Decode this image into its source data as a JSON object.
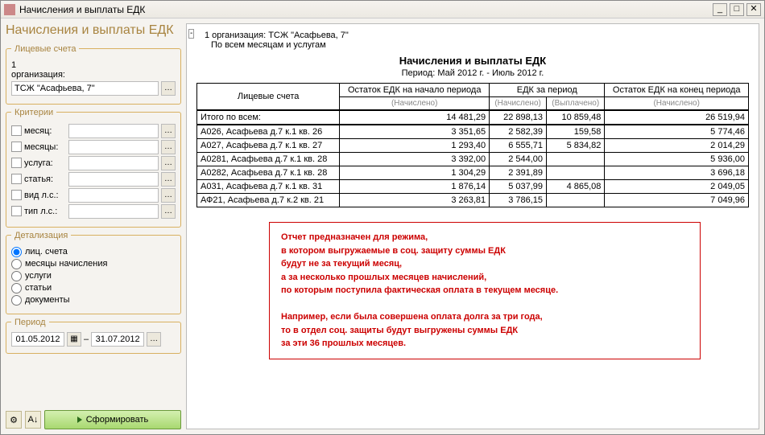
{
  "window": {
    "title": "Начисления и выплаты ЕДК"
  },
  "sidebar": {
    "heading": "Начисления и выплаты ЕДК",
    "accounts": {
      "legend": "Лицевые счета",
      "org_label": "1 организация:",
      "org_value": "ТСЖ \"Асафьева, 7\""
    },
    "criteria": {
      "legend": "Критерии",
      "items": [
        {
          "label": "месяц:"
        },
        {
          "label": "месяцы:"
        },
        {
          "label": "услуга:"
        },
        {
          "label": "статья:"
        },
        {
          "label": "вид л.с.:"
        },
        {
          "label": "тип л.с.:"
        }
      ]
    },
    "detail": {
      "legend": "Детализация",
      "items": [
        {
          "label": "лиц. счета",
          "checked": true
        },
        {
          "label": "месяцы начисления",
          "checked": false
        },
        {
          "label": "услуги",
          "checked": false
        },
        {
          "label": "статьи",
          "checked": false
        },
        {
          "label": "документы",
          "checked": false
        }
      ]
    },
    "period": {
      "legend": "Период",
      "from": "01.05.2012",
      "to": "31.07.2012"
    },
    "form_btn": "Сформировать"
  },
  "report": {
    "marker": "-",
    "orgline": "1 организация: ТСЖ \"Асафьева, 7\"",
    "subline": "По всем месяцам и услугам",
    "title": "Начисления и выплаты ЕДК",
    "period": "Период: Май 2012 г. - Июль 2012 г.",
    "headers": {
      "c1": "Лицевые счета",
      "c2": "Остаток ЕДК на начало периода",
      "c3": "ЕДК за период",
      "c4": "Остаток ЕДК на конец периода",
      "sub_accr": "(Начислено)",
      "sub_paid": "(Выплачено)"
    },
    "total_label": "Итого по всем:",
    "total": {
      "start": "14 481,29",
      "accr": "22 898,13",
      "paid": "10 859,48",
      "end": "26 519,94"
    },
    "rows": [
      {
        "name": "А026, Асафьева д.7 к.1 кв. 26",
        "start": "3 351,65",
        "accr": "2 582,39",
        "paid": "159,58",
        "end": "5 774,46"
      },
      {
        "name": "А027, Асафьева д.7 к.1 кв. 27",
        "start": "1 293,40",
        "accr": "6 555,71",
        "paid": "5 834,82",
        "end": "2 014,29"
      },
      {
        "name": "А0281, Асафьева д.7 к.1 кв. 28",
        "start": "3 392,00",
        "accr": "2 544,00",
        "paid": "",
        "end": "5 936,00"
      },
      {
        "name": "А0282, Асафьева д.7 к.1 кв. 28",
        "start": "1 304,29",
        "accr": "2 391,89",
        "paid": "",
        "end": "3 696,18"
      },
      {
        "name": "А031, Асафьева д.7 к.1 кв. 31",
        "start": "1 876,14",
        "accr": "5 037,99",
        "paid": "4 865,08",
        "end": "2 049,05"
      },
      {
        "name": "АФ21, Асафьева д.7 к.2 кв. 21",
        "start": "3 263,81",
        "accr": "3 786,15",
        "paid": "",
        "end": "7 049,96"
      }
    ],
    "note": {
      "l1": "Отчет предназначен для режима,",
      "l2": "в котором выгружаемые в соц. защиту суммы ЕДК",
      "l3": "будут не за текущий месяц,",
      "l4": "а за несколько прошлых месяцев начислений,",
      "l5": "по которым поступила фактическая оплата в текущем месяце.",
      "l6": "Например, если была совершена оплата долга за три года,",
      "l7": "то в отдел соц. защиты будут выгружены суммы ЕДК",
      "l8": "за эти 36 прошлых месяцев."
    }
  }
}
